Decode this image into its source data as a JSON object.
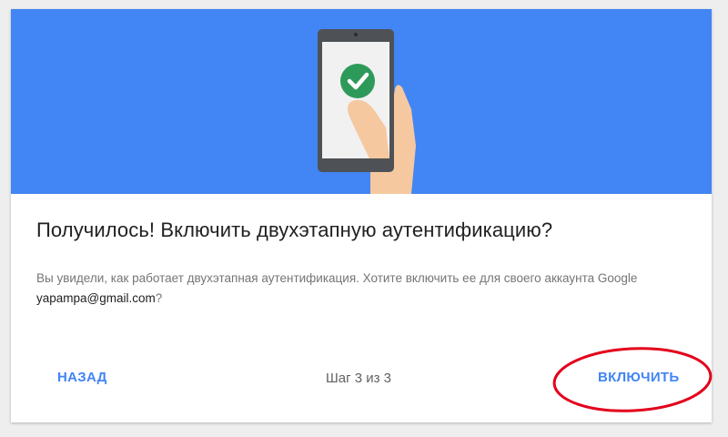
{
  "dialog": {
    "title": "Получилось! Включить двухэтапную аутентификацию?",
    "description": "Вы увидели, как работает двухэтапная аутентификация. Хотите включить ее для своего аккаунта Google ",
    "email": "yapampa@gmail.com",
    "description_end": "?",
    "back_label": "НАЗАД",
    "step_label": "Шаг 3 из 3",
    "enable_label": "ВКЛЮЧИТЬ"
  },
  "colors": {
    "hero_background": "#4285f4",
    "accent": "#4285f4",
    "checkmark_circle": "#2e9a5a",
    "annotation_circle": "#e3001b"
  },
  "icons": {
    "hero": "phone-in-hand-illustration",
    "check": "checkmark-icon"
  }
}
